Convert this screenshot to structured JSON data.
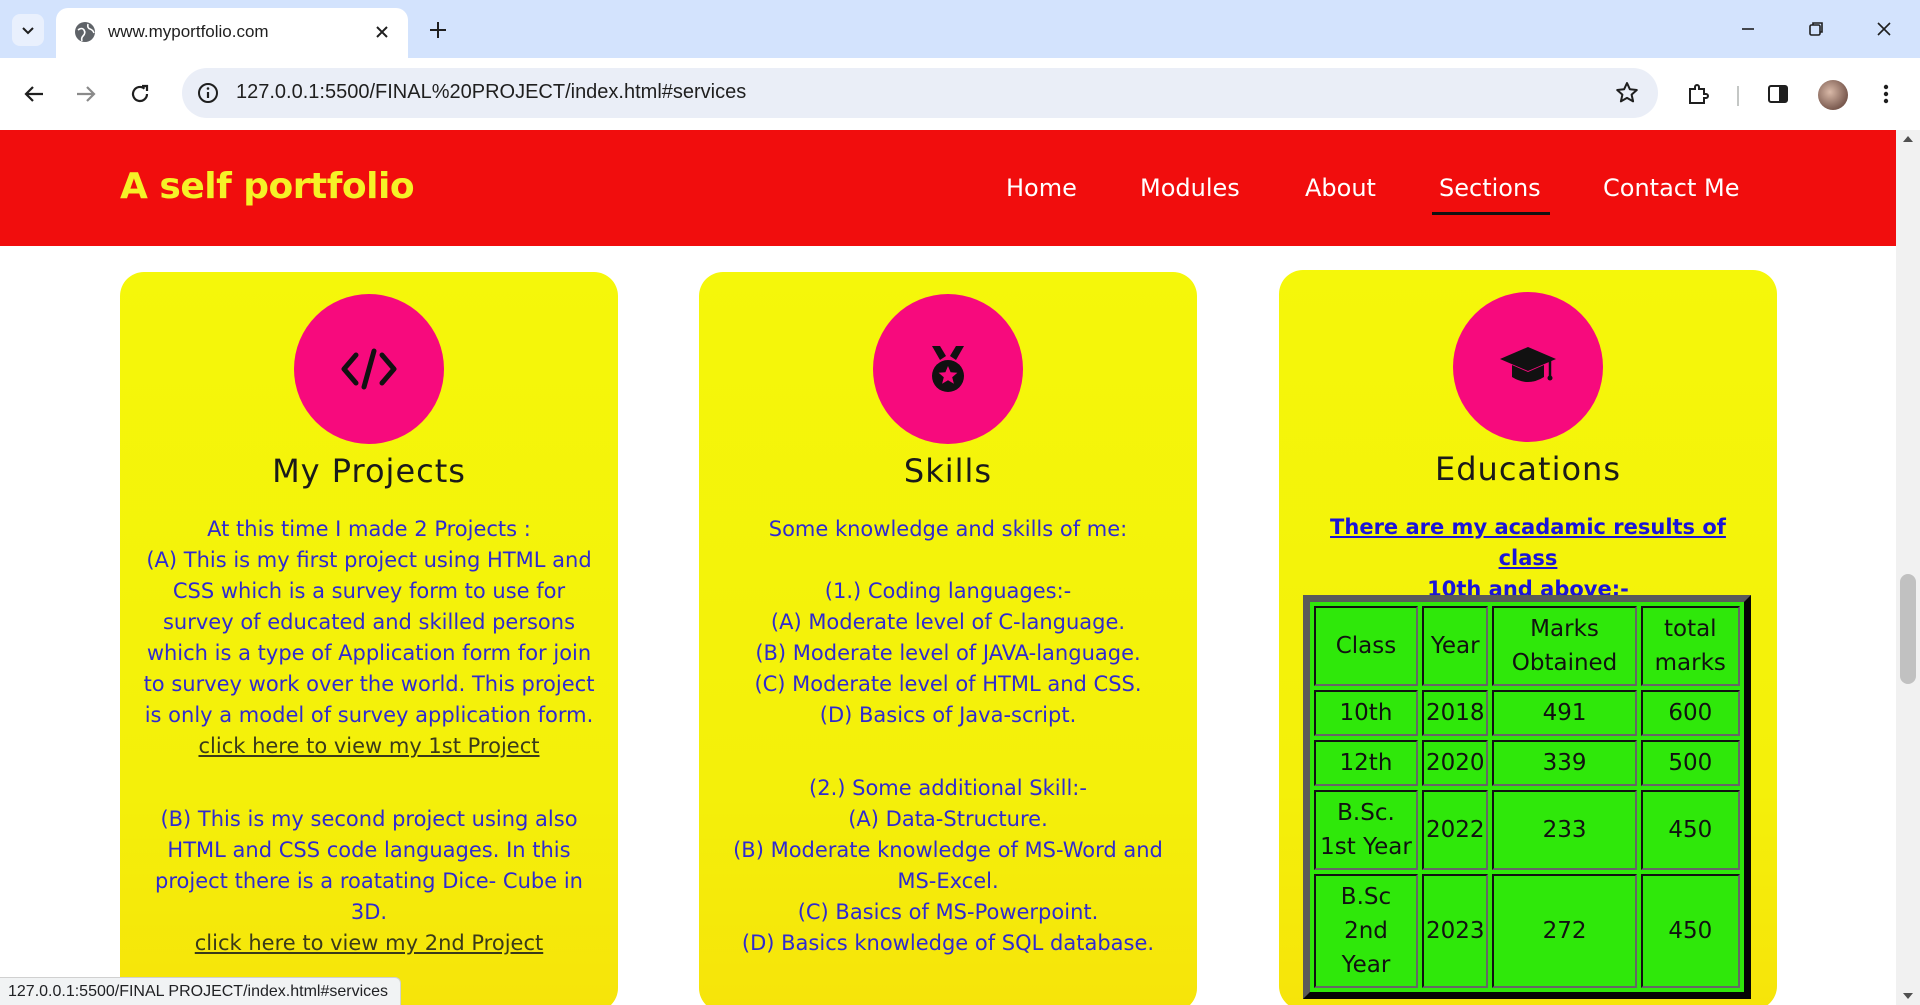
{
  "browser": {
    "tab_title": "www.myportfolio.com",
    "url": "127.0.0.1:5500/FINAL%20PROJECT/index.html#services",
    "status_url": "127.0.0.1:5500/FINAL PROJECT/index.html#services"
  },
  "site": {
    "brand": "A self portfolio",
    "nav": [
      "Home",
      "Modules",
      "About",
      "Sections",
      "Contact Me"
    ],
    "active_nav": "Sections",
    "accent_colors": {
      "header": "#f10d0d",
      "brand_text": "#f5f227",
      "card": "#f5f70a",
      "icon_circle": "#f70a7d",
      "body_text": "#2f2ad0",
      "table_bg": "#2fe80a"
    }
  },
  "cards": {
    "projects": {
      "icon": "code-icon",
      "title": "My Projects",
      "lines_a": [
        "At this time I made 2 Projects :",
        "(A) This is my first project using HTML and",
        "CSS which is a survey form to use for",
        "survey of educated and skilled persons",
        "which is a type of Application form for join",
        "to survey work over the world. This project",
        "is only a model of survey application form."
      ],
      "link_1": "click here to view my 1st Project",
      "lines_b": [
        "(B) This is my second project using also",
        "HTML and CSS code languages. In this",
        "project there is a roatating Dice- Cube in",
        "3D."
      ],
      "link_2": "click here to view my 2nd Project"
    },
    "skills": {
      "icon": "medal-icon",
      "title": "Skills",
      "intro": "Some knowledge and skills of me:",
      "coding": [
        "(1.) Coding languages:-",
        "(A) Moderate level of C-language.",
        "(B) Moderate level of JAVA-language.",
        "(C) Moderate level of HTML and CSS.",
        "(D) Basics of Java-script."
      ],
      "additional": [
        "(2.) Some additional Skill:-",
        "(A) Data-Structure.",
        "(B) Moderate knowledge of MS-Word and",
        "MS-Excel.",
        "(C) Basics of MS-Powerpoint.",
        "(D) Basics knowledge of SQL database."
      ]
    },
    "education": {
      "icon": "graduation-cap-icon",
      "title": "Educations",
      "link_line_1": "There are my acadamic results of class",
      "link_line_2": "10th and above:-",
      "table_headers": [
        "Class",
        "Year",
        "Marks Obtained",
        "total marks"
      ],
      "rows": [
        [
          "10th",
          "2018",
          "491",
          "600"
        ],
        [
          "12th",
          "2020",
          "339",
          "500"
        ],
        [
          "B.Sc. 1st Year",
          "2022",
          "233",
          "450"
        ],
        [
          "B.Sc 2nd Year",
          "2023",
          "272",
          "450"
        ]
      ]
    }
  }
}
